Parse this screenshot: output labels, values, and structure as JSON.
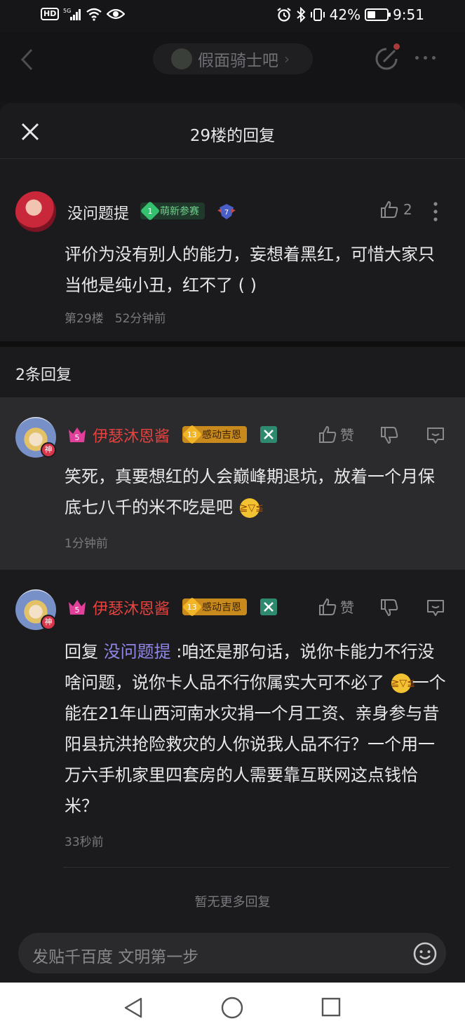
{
  "status_bar": {
    "left_badge": "HD",
    "battery_percent": "42%",
    "battery_level": 0.42,
    "time": "9:51"
  },
  "background_header": {
    "forum_name": "假面骑士吧"
  },
  "sheet": {
    "title": "29楼的回复",
    "main_post": {
      "username": "没问题提",
      "badge_level": "1",
      "badge_text": "萌新参赛",
      "rank_number": "7",
      "like_count": "2",
      "content": "评价为没有别人的能力，妄想着黑红，可惜大家只当他是纯小丑，红不了 ( )",
      "floor": "第29楼",
      "time": "52分钟前"
    },
    "reply_count_label": "2条回复",
    "replies": [
      {
        "username": "伊瑟沐恩酱",
        "vip_level": "5",
        "badge_level": "13",
        "badge_text": "感动吉恩",
        "god_mark": "神",
        "like_label": "赞",
        "content_before_emoji": "笑死，真要想红的人会巅峰期退坑，放着一个月保底七八千的米不吃是吧",
        "content_after_emoji": "",
        "time": "1分钟前"
      },
      {
        "username": "伊瑟沐恩酱",
        "vip_level": "5",
        "badge_level": "13",
        "badge_text": "感动吉恩",
        "god_mark": "神",
        "like_label": "赞",
        "reply_prefix": "回复 ",
        "mention": "没问题提",
        "content_before_emoji": " :咱还是那句话，说你卡能力不行没啥问题，说你卡人品不行你属实大可不必了",
        "content_after_emoji": "一个能在21年山西河南水灾捐一个月工资、亲身参与昔阳县抗洪抢险救灾的人你说我人品不行？一个用一万六手机家里四套房的人需要靠互联网这点钱恰米？",
        "time": "33秒前"
      }
    ],
    "empty_note": "暂无更多回复",
    "composer_placeholder": "发贴千百度 文明第一步"
  },
  "colors": {
    "accent_name_red": "#e8423f",
    "mention_purple": "#8f86e8",
    "sheet_bg": "#1b1b1d",
    "highlight_bg": "#2b2b2e"
  }
}
